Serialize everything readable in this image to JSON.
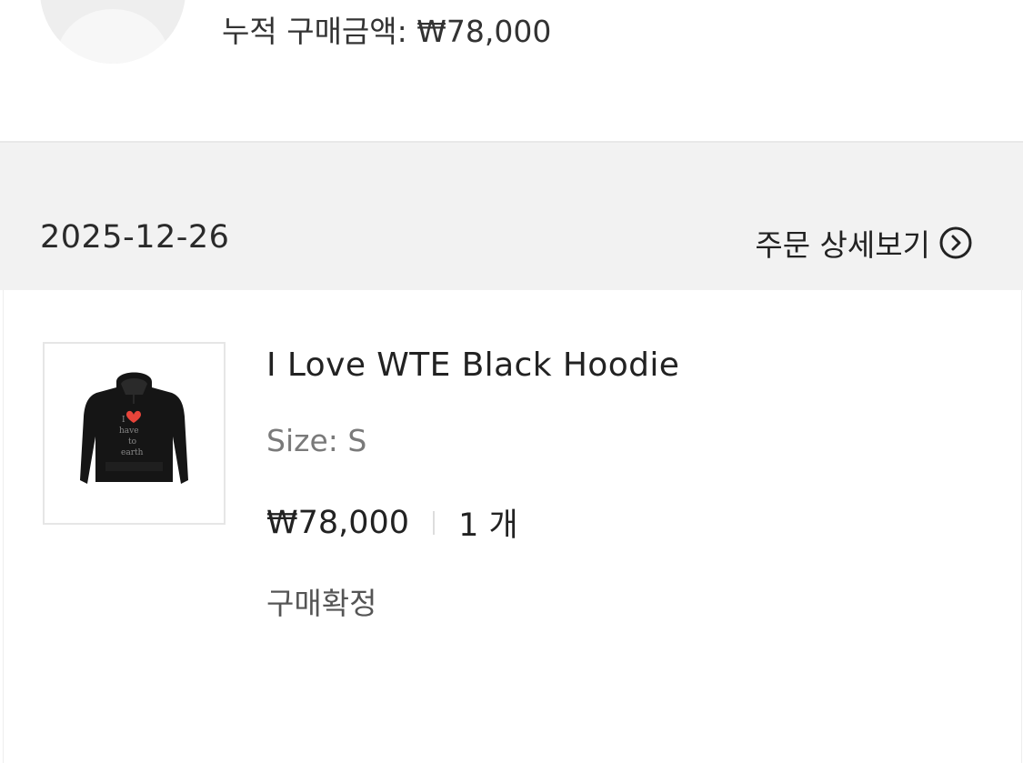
{
  "profile": {
    "total_label": "누적 구매금액: ₩78,000"
  },
  "order": {
    "date": "2025-12-26",
    "detail_link_label": "주문 상세보기",
    "detail_icon": "chevron-right-circle-icon",
    "items": [
      {
        "name": "I Love WTE Black Hoodie",
        "option": "Size: S",
        "price": "₩78,000",
        "quantity": "1 개",
        "status": "구매확정",
        "thumbnail_icon": "black-hoodie-image",
        "thumbnail_print": [
          "I",
          "have",
          "to",
          "earth"
        ]
      }
    ]
  },
  "colors": {
    "header_bg": "#f2f2f2",
    "heart": "#e8443a",
    "hoodie": "#151515"
  }
}
